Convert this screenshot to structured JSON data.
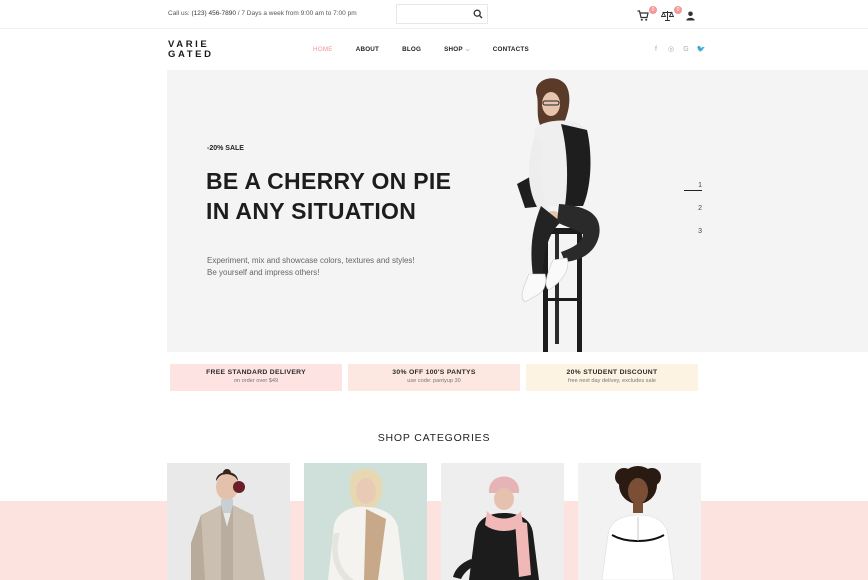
{
  "topbar": {
    "contact_prefix": "Call us: ",
    "phone": "(123) 456-7890",
    "hours": " / 7 Days a week from 9:00 am to 7:00 pm",
    "search_placeholder": "",
    "cart_count": "0",
    "compare_count": "0"
  },
  "header": {
    "logo_line1": "VARIE",
    "logo_line2": "GATED",
    "nav": [
      {
        "label": "HOME"
      },
      {
        "label": "ABOUT"
      },
      {
        "label": "BLOG"
      },
      {
        "label": "SHOP"
      },
      {
        "label": "CONTACTS"
      }
    ],
    "social": [
      "f",
      "◎",
      "G",
      "🐦"
    ]
  },
  "hero": {
    "sale": "-20% SALE",
    "headline_line1": "BE A CHERRY ON PIE",
    "headline_line2": "IN ANY SITUATION",
    "desc_line1": "Experiment, mix and showcase colors, textures and styles!",
    "desc_line2": "Be yourself and impress others!",
    "slides": [
      "1",
      "2",
      "3"
    ]
  },
  "promos": [
    {
      "title": "FREE STANDARD DELIVERY",
      "sub": "on order over $49",
      "color": "#fde3e1"
    },
    {
      "title": "30% OFF 100'S PANTYS",
      "sub": "use code: pantyup 30",
      "color": "#fce8e0"
    },
    {
      "title": "20% STUDENT DISCOUNT",
      "sub": "free next day delivey, excludes sale",
      "color": "#fdf3e3"
    }
  ],
  "categories": {
    "title": "SHOP CATEGORIES"
  },
  "colors": {
    "accent": "#f29595",
    "hero_bg": "#f4f4f4",
    "band": "#fde3df"
  }
}
